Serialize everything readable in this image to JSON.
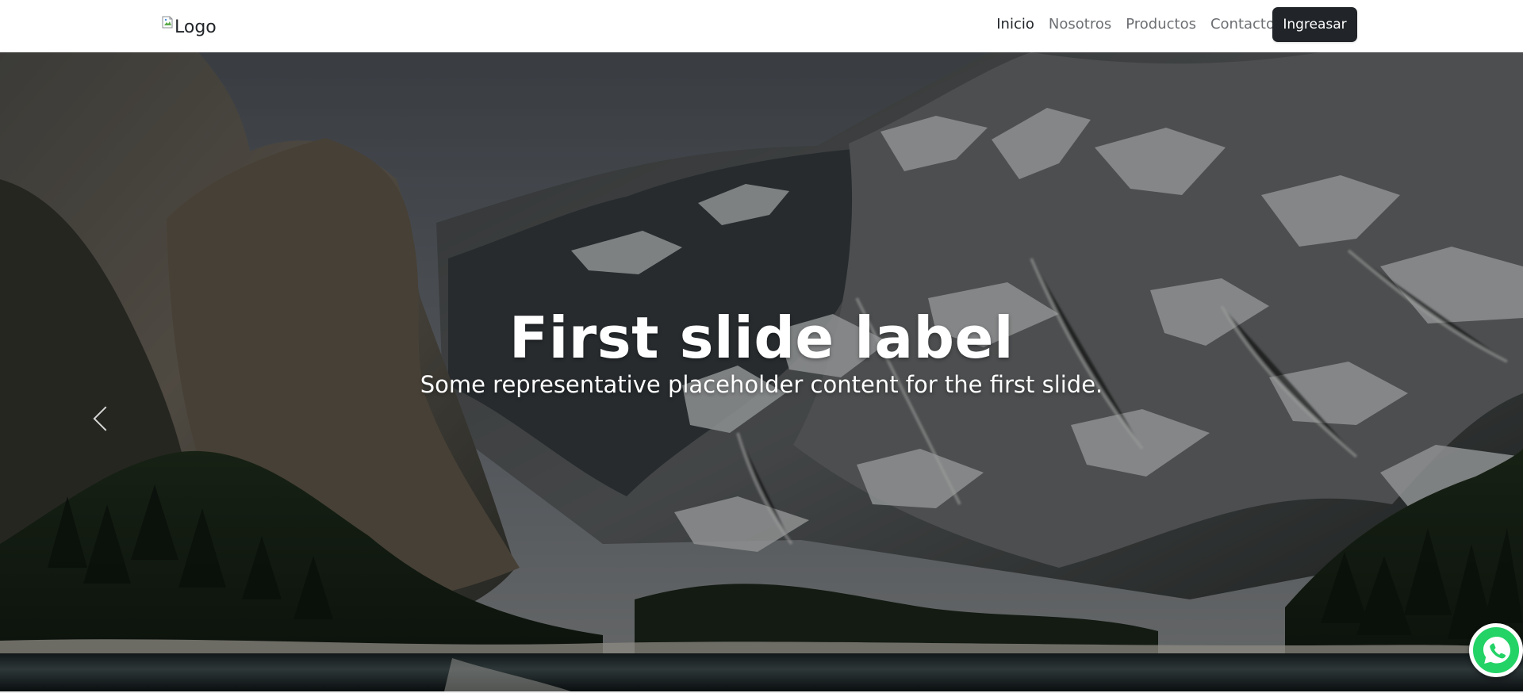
{
  "header": {
    "logo_alt": "Logo",
    "nav_items": [
      {
        "label": "Inicio",
        "active": true
      },
      {
        "label": "Nosotros",
        "active": false
      },
      {
        "label": "Productos",
        "active": false
      },
      {
        "label": "Contacto",
        "active": false
      }
    ],
    "login_label": "Ingreasar"
  },
  "carousel": {
    "slide_title": "First slide label",
    "slide_text": "Some representative placeholder content for the first slide.",
    "previous_icon": "chevron-left-icon"
  },
  "floating": {
    "whatsapp_icon": "whatsapp-icon",
    "whatsapp_color": "#25D366"
  },
  "theme": {
    "button_dark": "#212529",
    "active_nav": "#1F2328",
    "inactive_nav": "#6C6F73"
  }
}
